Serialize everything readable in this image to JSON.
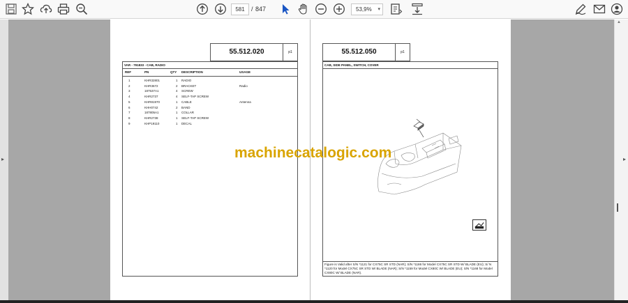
{
  "toolbar": {
    "current_page": "581",
    "page_separator": "/",
    "total_pages": "847",
    "zoom": "53,9%",
    "icons": [
      "save-icon",
      "bookmark-star-icon",
      "upload-icon",
      "print-icon",
      "zoom-search-icon",
      "page-up-icon",
      "page-down-icon",
      "select-cursor-icon",
      "hand-tool-icon",
      "zoom-out-icon",
      "zoom-in-icon",
      "fit-page-icon",
      "scroll-mode-icon",
      "edit-sign-icon",
      "mail-icon",
      "account-icon"
    ]
  },
  "left_page": {
    "code": "55.512.020",
    "page_label": "p1",
    "section_title": "VAR - 791833 - CAB, RADIO",
    "columns": {
      "ref": "REF",
      "pn": "PN",
      "qty": "QTY",
      "description": "DESCRIPTION",
      "usage": "USAGE"
    },
    "rows": [
      {
        "ref": "1",
        "pn": "KHR32801",
        "qty": "1",
        "description": "RADIO",
        "usage": ""
      },
      {
        "ref": "2",
        "pn": "KHR3672",
        "qty": "2",
        "description": "BRACKET",
        "usage": "Radio"
      },
      {
        "ref": "3",
        "pn": "187537A1",
        "qty": "4",
        "description": "SCREW",
        "usage": ""
      },
      {
        "ref": "4",
        "pn": "KHR2737",
        "qty": "4",
        "description": "SELF-TAP SCREW",
        "usage": ""
      },
      {
        "ref": "5",
        "pn": "KHR81970",
        "qty": "1",
        "description": "CABLE",
        "usage": "Antenna"
      },
      {
        "ref": "6",
        "pn": "KHH0742",
        "qty": "2",
        "description": "BAND",
        "usage": ""
      },
      {
        "ref": "7",
        "pn": "187805A1",
        "qty": "1",
        "description": "COLLAR",
        "usage": ""
      },
      {
        "ref": "8",
        "pn": "KHR2738",
        "qty": "1",
        "description": "SELF-TAP SCREW",
        "usage": ""
      },
      {
        "ref": "9",
        "pn": "KHP19110",
        "qty": "1",
        "description": "DECAL",
        "usage": ""
      }
    ]
  },
  "right_page": {
    "code": "55.512.050",
    "page_label": "p1",
    "section_title": "CAB, SIDE PANEL, SWITCH, COVER",
    "footer_note": "Figure is Valid after S/N *1121 for CX75C SR STD (NAR); S/N *1186 for Model CX75C SR STD W/ BLADE (EU); S/ N *1120 for Model CX75C SR STD W/ BLADE (NAR); S/N *1159 for Model CX80C W/ BLADE (EU); S/N *1168 for Model CX80C W/ BLADE (NAR)."
  },
  "watermark": "machinecatalogic.com",
  "colors": {
    "watermark": "#d9a400",
    "viewer_bg": "#a7a7a7",
    "toolbar_bg": "#f9f9f9"
  }
}
